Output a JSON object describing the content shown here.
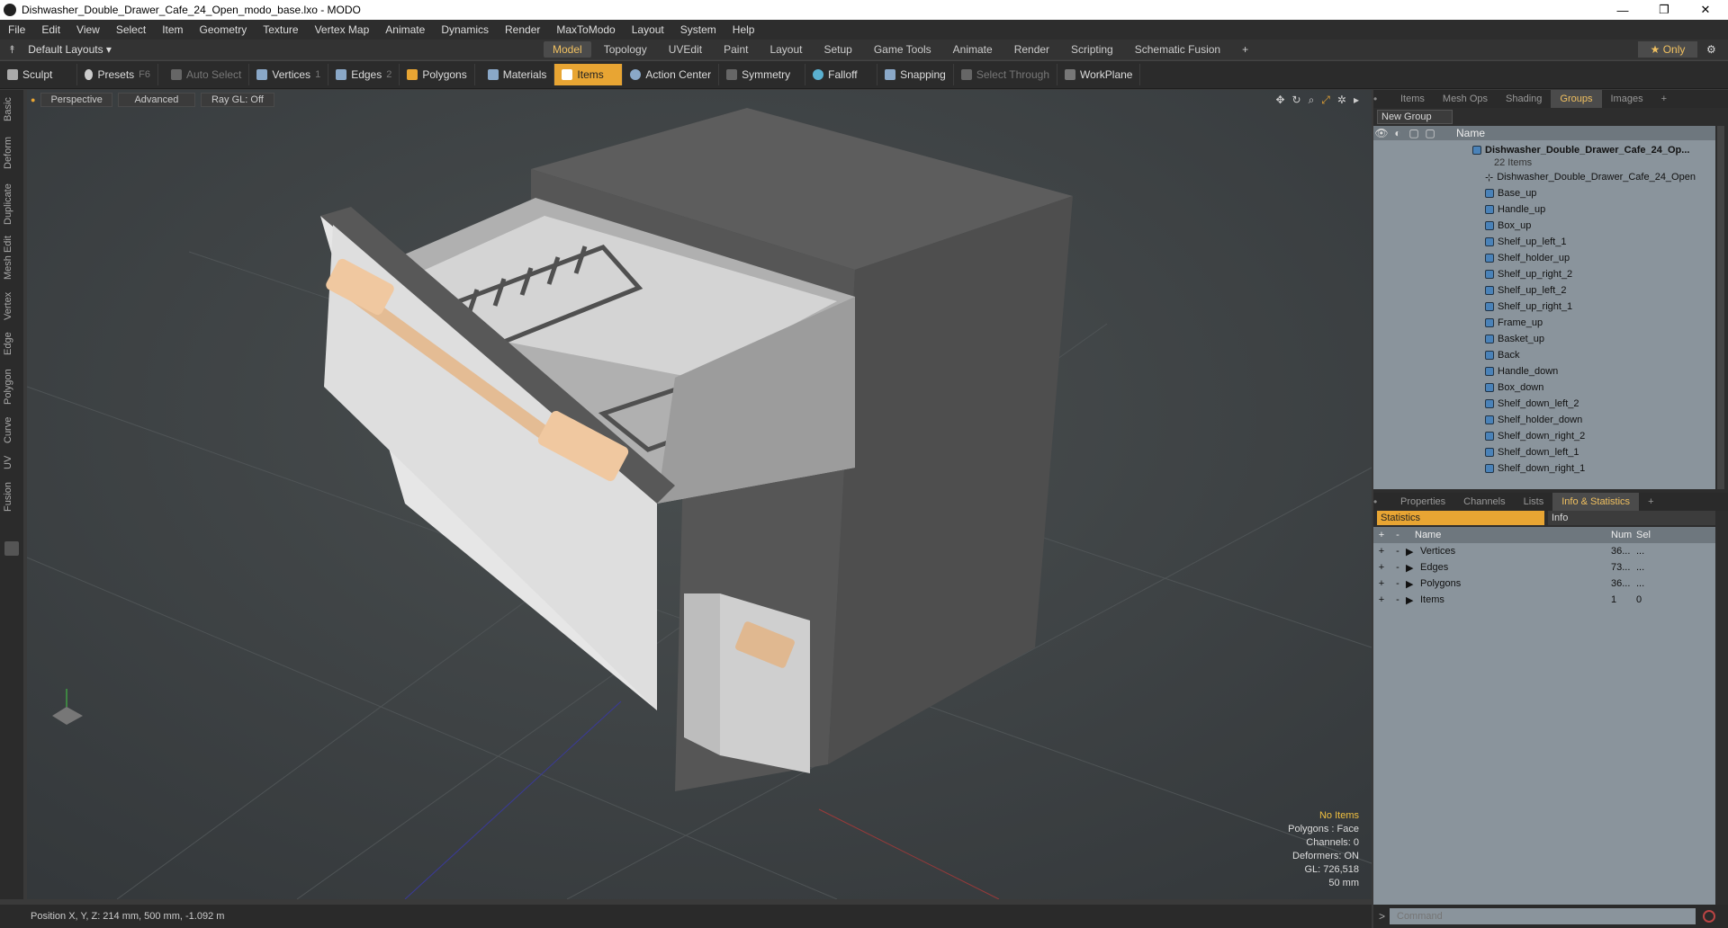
{
  "window": {
    "title": "Dishwasher_Double_Drawer_Cafe_24_Open_modo_base.lxo - MODO",
    "minimize": "—",
    "maximize": "❐",
    "close": "✕"
  },
  "menu": [
    "File",
    "Edit",
    "View",
    "Select",
    "Item",
    "Geometry",
    "Texture",
    "Vertex Map",
    "Animate",
    "Dynamics",
    "Render",
    "MaxToModo",
    "Layout",
    "System",
    "Help"
  ],
  "layoutbar": {
    "layouts": "Default Layouts ▾",
    "tabs": [
      "Model",
      "Topology",
      "UVEdit",
      "Paint",
      "Layout",
      "Setup",
      "Game Tools",
      "Animate",
      "Render",
      "Scripting",
      "Schematic Fusion"
    ],
    "active": "Model",
    "add": "+",
    "only": "★ Only"
  },
  "toolbar": {
    "sculpt": "Sculpt",
    "presets": "Presets",
    "presets_key": "F6",
    "auto_select": "Auto Select",
    "vertices": "Vertices",
    "vertices_key": "1",
    "edges": "Edges",
    "edges_key": "2",
    "polygons": "Polygons",
    "materials": "Materials",
    "items": "Items",
    "action_center": "Action Center",
    "symmetry": "Symmetry",
    "falloff": "Falloff",
    "snapping": "Snapping",
    "select_through": "Select Through",
    "workplane": "WorkPlane"
  },
  "leftstrip": [
    "Basic",
    "Deform",
    "Duplicate",
    "Mesh Edit",
    "Vertex",
    "Edge",
    "Polygon",
    "Curve",
    "UV",
    "Fusion"
  ],
  "viewport": {
    "perspective": "Perspective",
    "advanced": "Advanced",
    "raygl": "Ray GL: Off",
    "hud": {
      "no_items": "No Items",
      "polygons": "Polygons : Face",
      "channels": "Channels: 0",
      "deformers": "Deformers: ON",
      "gl": "GL: 726,518",
      "scale": "50 mm"
    }
  },
  "status": {
    "position": "Position X, Y, Z:   214 mm, 500 mm, -1.092 m"
  },
  "groups_panel": {
    "tabs": [
      "Items",
      "Mesh Ops",
      "Shading",
      "Groups",
      "Images"
    ],
    "active": "Groups",
    "add": "+",
    "new_group": "New Group",
    "col_name": "Name",
    "root": "Dishwasher_Double_Drawer_Cafe_24_Op...",
    "root_count": "22 Items",
    "locator": "Dishwasher_Double_Drawer_Cafe_24_Open",
    "items": [
      "Base_up",
      "Handle_up",
      "Box_up",
      "Shelf_up_left_1",
      "Shelf_holder_up",
      "Shelf_up_right_2",
      "Shelf_up_left_2",
      "Shelf_up_right_1",
      "Frame_up",
      "Basket_up",
      "Back",
      "Handle_down",
      "Box_down",
      "Shelf_down_left_2",
      "Shelf_holder_down",
      "Shelf_down_right_2",
      "Shelf_down_left_1",
      "Shelf_down_right_1"
    ]
  },
  "info_panel": {
    "tabs": [
      "Properties",
      "Channels",
      "Lists",
      "Info & Statistics"
    ],
    "active": "Info & Statistics",
    "add": "+",
    "stats_tab": "Statistics",
    "info_tab": "Info",
    "cols": {
      "name": "Name",
      "num": "Num",
      "sel": "Sel"
    },
    "rows": [
      {
        "name": "Vertices",
        "num": "36...",
        "sel": "..."
      },
      {
        "name": "Edges",
        "num": "73...",
        "sel": "..."
      },
      {
        "name": "Polygons",
        "num": "36...",
        "sel": "..."
      },
      {
        "name": "Items",
        "num": "1",
        "sel": "0"
      }
    ]
  },
  "command": {
    "placeholder": "Command",
    "prompt": ">"
  }
}
